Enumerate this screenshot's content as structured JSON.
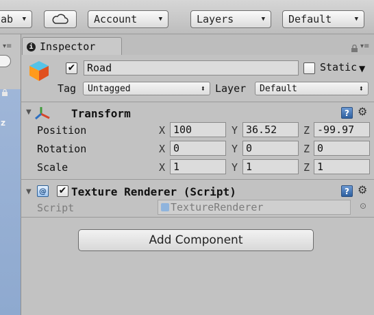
{
  "toolbar": {
    "prefab_partial": "ab",
    "cloud_icon": "cloud-icon",
    "account_label": "Account",
    "layers_label": "Layers",
    "layout_label": "Default"
  },
  "left_panel": {
    "letter": "z"
  },
  "inspector": {
    "tab_label": "Inspector",
    "tab_icon": "info-icon",
    "object": {
      "active": true,
      "name": "Road",
      "static_label": "Static",
      "tag_label": "Tag",
      "tag_value": "Untagged",
      "layer_label": "Layer",
      "layer_value": "Default"
    },
    "transform": {
      "title": "Transform",
      "rows": [
        {
          "label": "Position",
          "x": "100",
          "y": "36.52",
          "z": "-99.97"
        },
        {
          "label": "Rotation",
          "x": "0",
          "y": "0",
          "z": "0"
        },
        {
          "label": "Scale",
          "x": "1",
          "y": "1",
          "z": "1"
        }
      ]
    },
    "texture_renderer": {
      "title": "Texture Renderer (Script)",
      "enabled": true,
      "script_label": "Script",
      "script_value": "TextureRenderer"
    },
    "add_component_label": "Add Component"
  },
  "colors": {
    "panel_bg": "#c2c2c2",
    "scene_blue": "#95aed3",
    "transform_icon_red": "#d6462c",
    "transform_icon_green": "#3f9b3a",
    "transform_icon_blue": "#2d6fc0"
  }
}
